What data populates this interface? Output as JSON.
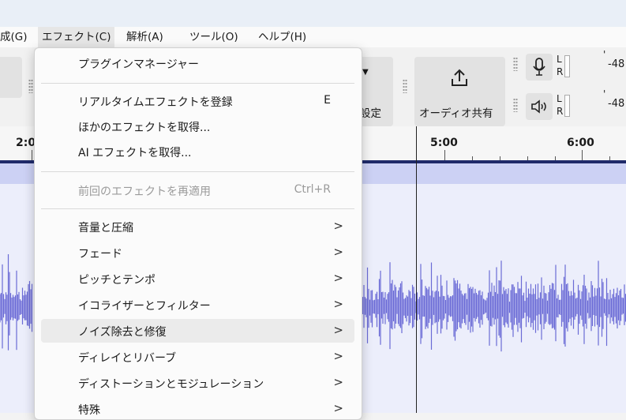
{
  "menubar": {
    "items": [
      "成(G)",
      "エフェクト(C)",
      "解析(A)",
      "ツール(O)",
      "ヘルプ(H)"
    ]
  },
  "toolbar": {
    "settings_label": "設定",
    "share_label": "オーディオ共有",
    "meter_left": "L",
    "meter_right": "R",
    "meter_db": "-48",
    "meter_tick": "'"
  },
  "ruler": {
    "labels": [
      "2:0",
      "5:00",
      "6:00"
    ]
  },
  "effects_menu": {
    "plugin_manager": "プラグインマネージャー",
    "register_realtime": "リアルタイムエフェクトを登録",
    "register_realtime_shortcut": "E",
    "get_more": "ほかのエフェクトを取得...",
    "get_ai": "AI エフェクトを取得...",
    "repeat_last": "前回のエフェクトを再適用",
    "repeat_last_shortcut": "Ctrl+R",
    "submenus": [
      "音量と圧縮",
      "フェード",
      "ピッチとテンポ",
      "イコライザーとフィルター",
      "ノイズ除去と修復",
      "ディレイとリバーブ",
      "ディストーションとモジュレーション",
      "特殊"
    ],
    "chevron": ">"
  },
  "colors": {
    "waveform": "#6b6bd6",
    "selection": "#ccd1f4",
    "track_bg": "#eceefb",
    "timeline": "#1f2a6a"
  }
}
